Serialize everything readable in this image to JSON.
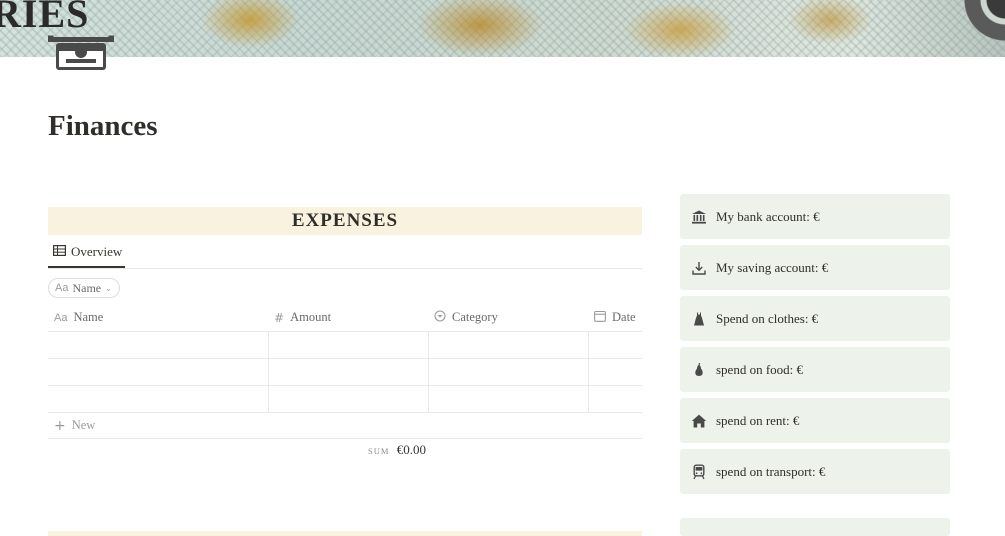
{
  "page": {
    "title": "Finances",
    "cover_text": "RIES"
  },
  "expenses": {
    "header": "EXPENSES",
    "tab_label": "Overview",
    "filter_label": "Name",
    "filter_prefix": "Aa",
    "columns": [
      {
        "label": "Name",
        "icon": "Aa"
      },
      {
        "label": "Amount",
        "icon": "#"
      },
      {
        "label": "Category",
        "icon": "select-icon"
      },
      {
        "label": "Date",
        "icon": "calendar-icon"
      }
    ],
    "rows": [
      [
        "",
        "",
        "",
        ""
      ],
      [
        "",
        "",
        "",
        ""
      ],
      [
        "",
        "",
        "",
        ""
      ]
    ],
    "new_label": "New",
    "sum_label": "SUM",
    "sum_value": "€0.00"
  },
  "callouts": [
    {
      "icon": "bank-icon",
      "text": "My bank account: €"
    },
    {
      "icon": "download-icon",
      "text": "My saving account: €"
    },
    {
      "icon": "dress-icon",
      "text": "Spend on clothes: €"
    },
    {
      "icon": "pear-icon",
      "text": "spend on food: €"
    },
    {
      "icon": "house-icon",
      "text": "spend on rent: €"
    },
    {
      "icon": "train-icon",
      "text": "spend on transport: €"
    }
  ]
}
